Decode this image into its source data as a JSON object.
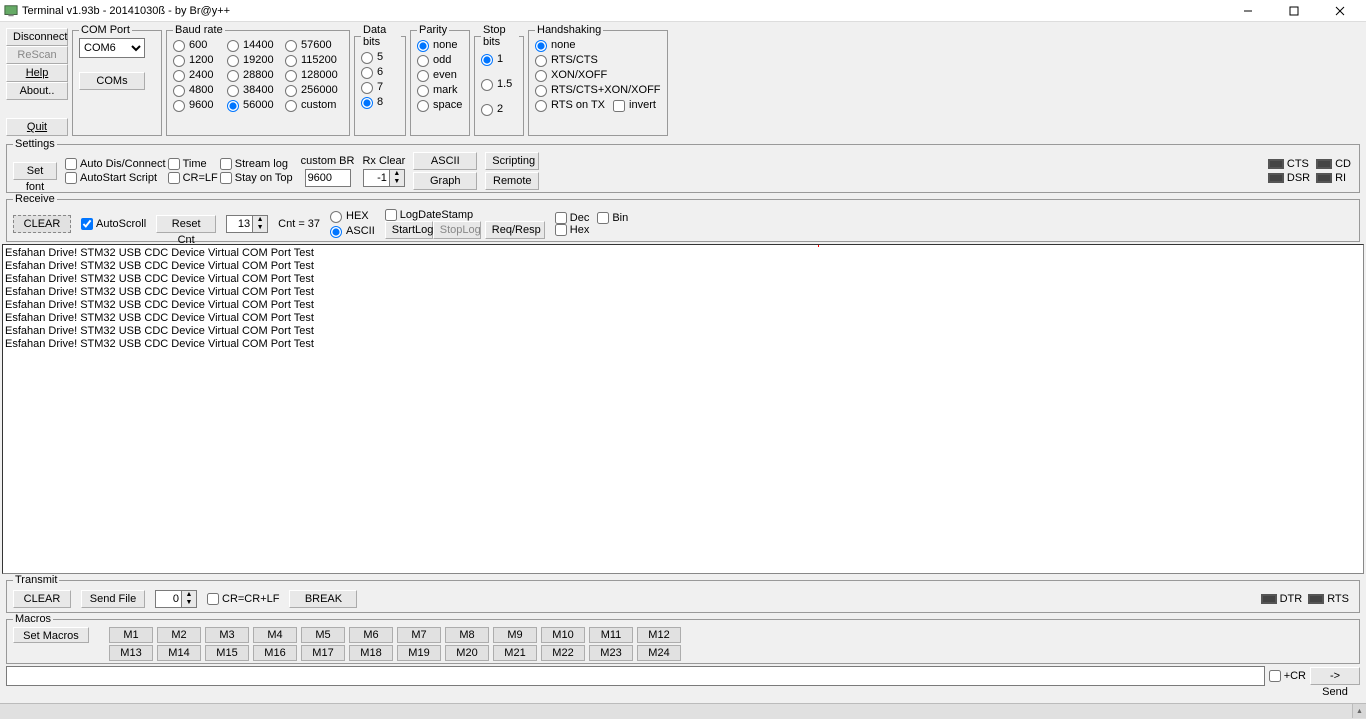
{
  "window": {
    "title": "Terminal v1.93b - 20141030ß - by Br@y++"
  },
  "sidebar_buttons": {
    "disconnect": "Disconnect",
    "rescan": "ReScan",
    "help": "Help",
    "about": "About..",
    "quit": "Quit"
  },
  "comport": {
    "legend": "COM Port",
    "selected": "COM6",
    "coms_btn": "COMs"
  },
  "baud": {
    "legend": "Baud rate",
    "col1": [
      "600",
      "1200",
      "2400",
      "4800",
      "9600"
    ],
    "col2": [
      "14400",
      "19200",
      "28800",
      "38400",
      "56000"
    ],
    "col3": [
      "57600",
      "115200",
      "128000",
      "256000",
      "custom"
    ],
    "selected": "56000"
  },
  "databits": {
    "legend": "Data bits",
    "options": [
      "5",
      "6",
      "7",
      "8"
    ],
    "selected": "8"
  },
  "parity": {
    "legend": "Parity",
    "options": [
      "none",
      "odd",
      "even",
      "mark",
      "space"
    ],
    "selected": "none"
  },
  "stopbits": {
    "legend": "Stop bits",
    "options": [
      "1",
      "1.5",
      "2"
    ],
    "selected": "1"
  },
  "handshake": {
    "legend": "Handshaking",
    "options": [
      "none",
      "RTS/CTS",
      "XON/XOFF",
      "RTS/CTS+XON/XOFF",
      "RTS on TX"
    ],
    "invert": "invert",
    "selected": "none"
  },
  "settings": {
    "legend": "Settings",
    "setfont": "Set font",
    "checks": {
      "autodis": "Auto Dis/Connect",
      "autostart": "AutoStart Script",
      "time": "Time",
      "crlf": "CR=LF",
      "streamlog": "Stream log",
      "stayontop": "Stay on Top"
    },
    "customBR_lbl": "custom BR",
    "customBR_val": "9600",
    "rxclear_lbl": "Rx Clear",
    "rxclear_val": "-1",
    "asciitable": "ASCII table",
    "graph": "Graph",
    "scripting": "Scripting",
    "remote": "Remote",
    "leds": {
      "cts": "CTS",
      "cd": "CD",
      "dsr": "DSR",
      "ri": "RI"
    }
  },
  "receive": {
    "legend": "Receive",
    "clear": "CLEAR",
    "autoscroll": "AutoScroll",
    "resetcnt": "Reset Cnt",
    "spin_val": "13",
    "cnt_lbl": "Cnt =  37",
    "hex": "HEX",
    "ascii": "ASCII",
    "logdatestamp": "LogDateStamp",
    "startlog": "StartLog",
    "stoplog": "StopLog",
    "reqresp": "Req/Resp",
    "dec": "Dec",
    "bin": "Bin",
    "hex2": "Hex",
    "lines": [
      "Esfahan Drive! STM32 USB CDC Device Virtual COM Port Test",
      "Esfahan Drive! STM32 USB CDC Device Virtual COM Port Test",
      "Esfahan Drive! STM32 USB CDC Device Virtual COM Port Test",
      "Esfahan Drive! STM32 USB CDC Device Virtual COM Port Test",
      "Esfahan Drive! STM32 USB CDC Device Virtual COM Port Test",
      "Esfahan Drive! STM32 USB CDC Device Virtual COM Port Test",
      "Esfahan Drive! STM32 USB CDC Device Virtual COM Port Test",
      "Esfahan Drive! STM32 USB CDC Device Virtual COM Port Test"
    ]
  },
  "transmit": {
    "legend": "Transmit",
    "clear": "CLEAR",
    "sendfile": "Send File",
    "spin_val": "0",
    "crcrLf": "CR=CR+LF",
    "break": "BREAK",
    "dtr": "DTR",
    "rts": "RTS"
  },
  "macros": {
    "legend": "Macros",
    "setmacros": "Set Macros",
    "row1": [
      "M1",
      "M2",
      "M3",
      "M4",
      "M5",
      "M6",
      "M7",
      "M8",
      "M9",
      "M10",
      "M11",
      "M12"
    ],
    "row2": [
      "M13",
      "M14",
      "M15",
      "M16",
      "M17",
      "M18",
      "M19",
      "M20",
      "M21",
      "M22",
      "M23",
      "M24"
    ]
  },
  "send": {
    "plus_cr": "+CR",
    "send_btn": "-> Send"
  }
}
